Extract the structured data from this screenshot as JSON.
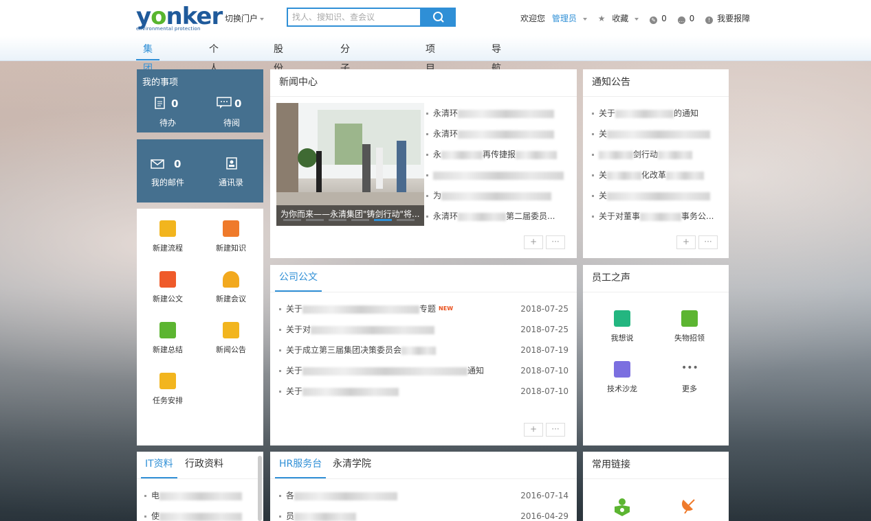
{
  "header": {
    "logo_text": "yonker",
    "logo_tagline": "environmental protection",
    "switch_label": "切换门户",
    "search_placeholder": "找人、搜知识、查会议",
    "welcome": "欢迎您",
    "user": "管理员",
    "favorites": "收藏",
    "count_a": "0",
    "count_b": "0",
    "report": "我要报障"
  },
  "nav": [
    "集团门户",
    "个人门户",
    "股份门户",
    "分子公司门户",
    "项目门户",
    "导航门户"
  ],
  "my_items": {
    "title": "我的事项",
    "todo_count": "0",
    "todo_label": "待办",
    "toread_count": "0",
    "toread_label": "待阅",
    "mail_count": "0",
    "mail_label": "我的邮件",
    "contacts_label": "通讯录"
  },
  "quick": [
    "新建流程",
    "新建知识",
    "新建公文",
    "新建会议",
    "新建总结",
    "新闻公告",
    "任务安排"
  ],
  "news": {
    "title": "新闻中心",
    "caption": "为你而来——永清集团\"铸剑行动\"将...",
    "items": [
      "永清环",
      "永清环",
      "永",
      "再传捷报",
      "为",
      "永清环",
      "第二届委员..."
    ]
  },
  "notice": {
    "title": "通知公告",
    "items": [
      "关于",
      "的通知",
      "关",
      "剑行动",
      "关",
      "化改革",
      "关",
      "关于对董事",
      "事务公..."
    ]
  },
  "docs": {
    "title": "公司公文",
    "rows": [
      {
        "prefix": "关于",
        "tail": "专题",
        "new": "NEW",
        "date": "2018-07-25"
      },
      {
        "prefix": "关于对",
        "tail": "",
        "new": "",
        "date": "2018-07-25"
      },
      {
        "prefix": "关于成立第三届集团决策委员会",
        "tail": "",
        "new": "",
        "date": "2018-07-19"
      },
      {
        "prefix": "关于",
        "tail": "通知",
        "new": "",
        "date": "2018-07-10"
      },
      {
        "prefix": "关于",
        "tail": "",
        "new": "",
        "date": "2018-07-10"
      }
    ]
  },
  "voice": {
    "title": "员工之声",
    "items": [
      "我想说",
      "失物招领",
      "技术沙龙",
      "更多"
    ]
  },
  "it": {
    "tab1": "IT资料",
    "tab2": "行政资料",
    "items": [
      "电",
      "使"
    ]
  },
  "hr": {
    "tab1": "HR服务台",
    "tab2": "永清学院",
    "rows": [
      {
        "prefix": "各",
        "date": "2016-07-14"
      },
      {
        "prefix": "员",
        "date": "2016-04-29"
      }
    ]
  },
  "links": {
    "title": "常用链接"
  },
  "colors": {
    "accent": "#2f8fd6",
    "panel_blue": "#45708f"
  }
}
